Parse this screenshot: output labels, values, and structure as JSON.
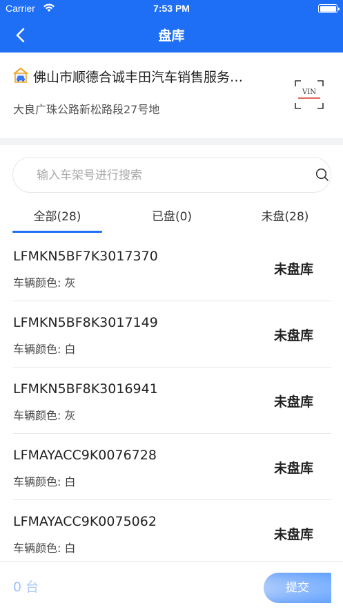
{
  "status_bar": {
    "carrier": "Carrier",
    "time": "7:53 PM"
  },
  "nav": {
    "title": "盘库"
  },
  "shop": {
    "name": "佛山市顺德合诚丰田汽车销售服务…",
    "address": "大良广珠公路新松路段27号地",
    "vin_label": "VIN"
  },
  "search": {
    "placeholder": "输入车架号进行搜索",
    "value": ""
  },
  "tabs": [
    {
      "label": "全部(28)",
      "active": true
    },
    {
      "label": "已盘(0)",
      "active": false
    },
    {
      "label": "未盘(28)",
      "active": false
    }
  ],
  "vehicles": [
    {
      "vin": "LFMKN5BF7K3017370",
      "color": "车辆颜色: 灰",
      "status": "未盘库"
    },
    {
      "vin": "LFMKN5BF8K3017149",
      "color": "车辆颜色: 白",
      "status": "未盘库"
    },
    {
      "vin": "LFMKN5BF8K3016941",
      "color": "车辆颜色: 灰",
      "status": "未盘库"
    },
    {
      "vin": "LFMAYACC9K0076728",
      "color": "车辆颜色: 白",
      "status": "未盘库"
    },
    {
      "vin": "LFMAYACC9K0075062",
      "color": "车辆颜色: 白",
      "status": "未盘库"
    }
  ],
  "footer": {
    "count": "0 台",
    "submit_label": "提交"
  },
  "colors": {
    "primary": "#1e6ff5",
    "shop_icon_roof": "#f0a830",
    "vin_underline": "#d9342b"
  }
}
